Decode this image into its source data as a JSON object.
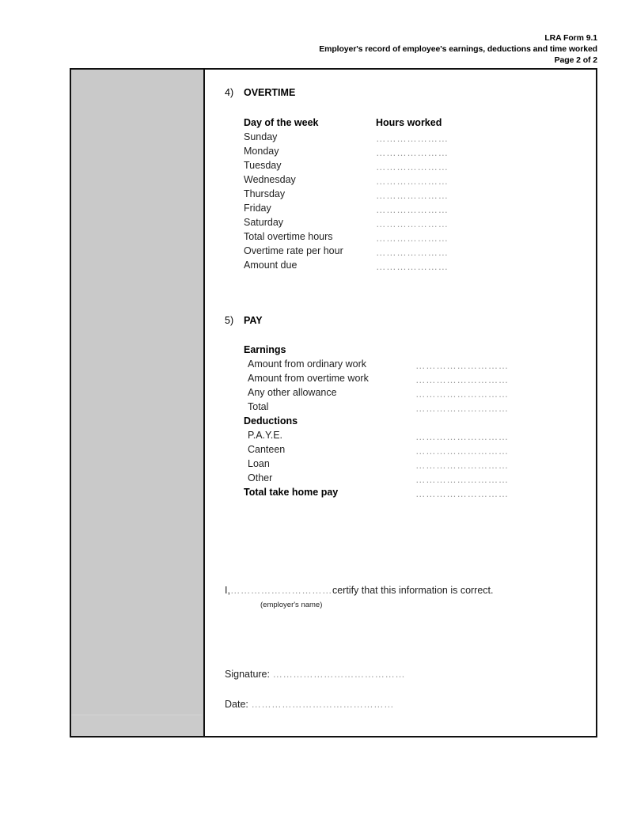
{
  "header": {
    "form_code": "LRA Form 9.1",
    "title": "Employer's record of employee's earnings, deductions and time worked",
    "page_indicator": "Page 2 of 2"
  },
  "sections": {
    "overtime": {
      "number": "4)",
      "title": "OVERTIME",
      "columns": {
        "day": "Day of the week",
        "hours": "Hours worked"
      },
      "rows": [
        {
          "label": "Sunday",
          "value": "…………………"
        },
        {
          "label": "Monday",
          "value": "…………………"
        },
        {
          "label": "Tuesday",
          "value": "…………………"
        },
        {
          "label": "Wednesday",
          "value": "…………………"
        },
        {
          "label": "Thursday",
          "value": "…………………"
        },
        {
          "label": "Friday",
          "value": "…………………"
        },
        {
          "label": "Saturday",
          "value": "…………………"
        },
        {
          "label": "Total overtime hours",
          "value": "…………………"
        },
        {
          "label": "Overtime rate per hour",
          "value": "…………………"
        },
        {
          "label": "Amount due",
          "value": "…………………"
        }
      ]
    },
    "pay": {
      "number": "5)",
      "title": "PAY",
      "earnings_heading": "Earnings",
      "earnings_rows": [
        {
          "label": "Amount from ordinary work",
          "value": "………………………"
        },
        {
          "label": "Amount from overtime work",
          "value": "………………………"
        },
        {
          "label": "Any other allowance",
          "value": "………………………"
        },
        {
          "label": "Total",
          "value": "………………………"
        }
      ],
      "deductions_heading": "Deductions",
      "deductions_rows": [
        {
          "label": "P.A.Y.E.",
          "value": "………………………"
        },
        {
          "label": "Canteen",
          "value": "………………………"
        },
        {
          "label": "Loan",
          "value": "………………………"
        },
        {
          "label": "Other",
          "value": "………………………"
        }
      ],
      "total_row": {
        "label": "Total take home pay",
        "value": "………………………"
      }
    }
  },
  "declaration": {
    "prefix": "I,",
    "blank": "…………………………",
    "statement": "certify that this information is correct.",
    "hint": "(employer's name)",
    "signature_label": "Signature:",
    "signature_blank": "…………………………………",
    "date_label": "Date:",
    "date_blank": "……………………………………"
  },
  "colors": {
    "shaded_column": "#c9c9c9",
    "frame_border": "#111111",
    "dot_leader": "#9a9a9a"
  }
}
